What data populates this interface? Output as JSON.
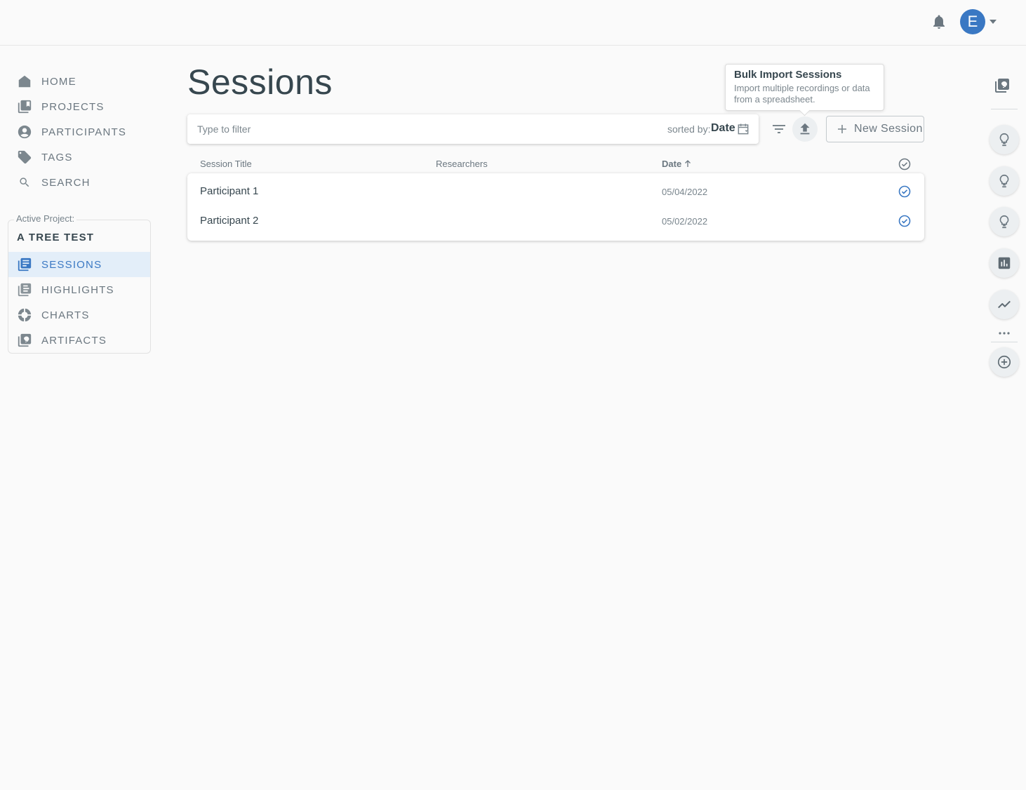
{
  "topbar": {
    "avatar_letter": "E",
    "icons": [
      "bell-icon",
      "chevron-down-icon"
    ]
  },
  "nav": {
    "items": [
      {
        "label": "HOME",
        "icon": "home-icon"
      },
      {
        "label": "PROJECTS",
        "icon": "projects-icon"
      },
      {
        "label": "PARTICIPANTS",
        "icon": "participant-icon"
      },
      {
        "label": "TAGS",
        "icon": "tag-icon"
      },
      {
        "label": "SEARCH",
        "icon": "search-icon"
      }
    ]
  },
  "project": {
    "caption": "Active Project:",
    "name": "A TREE TEST",
    "items": [
      {
        "label": "SESSIONS",
        "icon": "sessions-icon",
        "active": true
      },
      {
        "label": "HIGHLIGHTS",
        "icon": "highlights-icon"
      },
      {
        "label": "CHARTS",
        "icon": "charts-icon"
      },
      {
        "label": "ARTIFACTS",
        "icon": "artifacts-icon"
      }
    ]
  },
  "page": {
    "title": "Sessions"
  },
  "filter": {
    "placeholder": "Type to filter",
    "sort_label": "sorted by:",
    "sort_value": "Date"
  },
  "toolbar": {
    "new_session_label": "New Session"
  },
  "tooltip": {
    "title": "Bulk Import Sessions",
    "body": "Import multiple recordings or data from a spreadsheet."
  },
  "table": {
    "columns": [
      "Session Title",
      "Researchers",
      "Date"
    ],
    "rows": [
      {
        "title": "Participant 1",
        "researchers": "",
        "date": "05/04/2022",
        "checked": true
      },
      {
        "title": "Participant 2",
        "researchers": "",
        "date": "05/02/2022",
        "checked": true
      }
    ]
  },
  "colors": {
    "accent": "#3a78c3",
    "active_bg": "#e3eef9",
    "text": "#37474f",
    "muted": "#6b7780"
  }
}
